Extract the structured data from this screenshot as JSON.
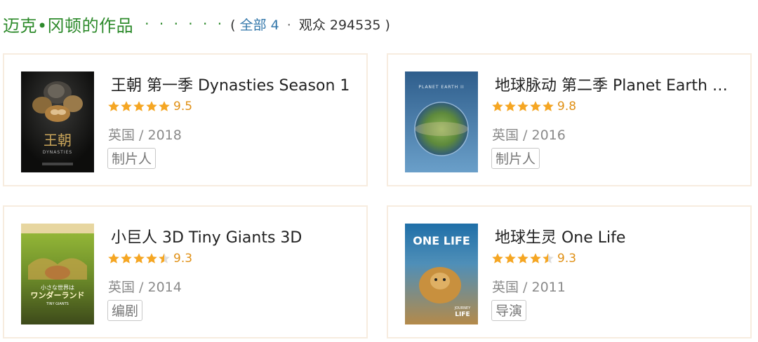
{
  "header": {
    "title": "迈克•冈顿的作品",
    "dots": "· · · · · ·",
    "open_paren": "(",
    "all_label": "全部 4",
    "separator": "·",
    "audience": "观众 294535",
    "close_paren": ")"
  },
  "works": [
    {
      "title": "王朝 第一季 Dynasties Season 1",
      "rating": 9.5,
      "rating_text": "9.5",
      "stars": 5,
      "meta": "英国 / 2018",
      "role": "制片人",
      "poster_icon": "dynasties-poster",
      "poster_texts": [
        "王朝",
        "DYNASTIES"
      ]
    },
    {
      "title": "地球脉动 第二季 Planet Earth …",
      "rating": 9.8,
      "rating_text": "9.8",
      "stars": 5,
      "meta": "英国 / 2016",
      "role": "制片人",
      "poster_icon": "planet-earth-poster",
      "poster_texts": [
        "PLANET EARTH II"
      ]
    },
    {
      "title": "小巨人 3D Tiny Giants 3D",
      "rating": 9.3,
      "rating_text": "9.3",
      "stars": 4.5,
      "meta": "英国 / 2014",
      "role": "编剧",
      "poster_icon": "tiny-giants-poster",
      "poster_texts": [
        "小さな世界は",
        "ワンダーランド",
        "TINY GIANTS"
      ]
    },
    {
      "title": "地球生灵 One Life",
      "rating": 9.3,
      "rating_text": "9.3",
      "stars": 4.5,
      "meta": "英国 / 2011",
      "role": "导演",
      "poster_icon": "one-life-poster",
      "poster_texts": [
        "ONE LIFE",
        "JOURNEY",
        "LIFE"
      ]
    }
  ],
  "colors": {
    "title_green": "#2d8a2b",
    "link_blue": "#3377aa",
    "star_gold": "#f5a623",
    "star_empty": "#dddddd",
    "card_border": "#f7ecdf"
  }
}
